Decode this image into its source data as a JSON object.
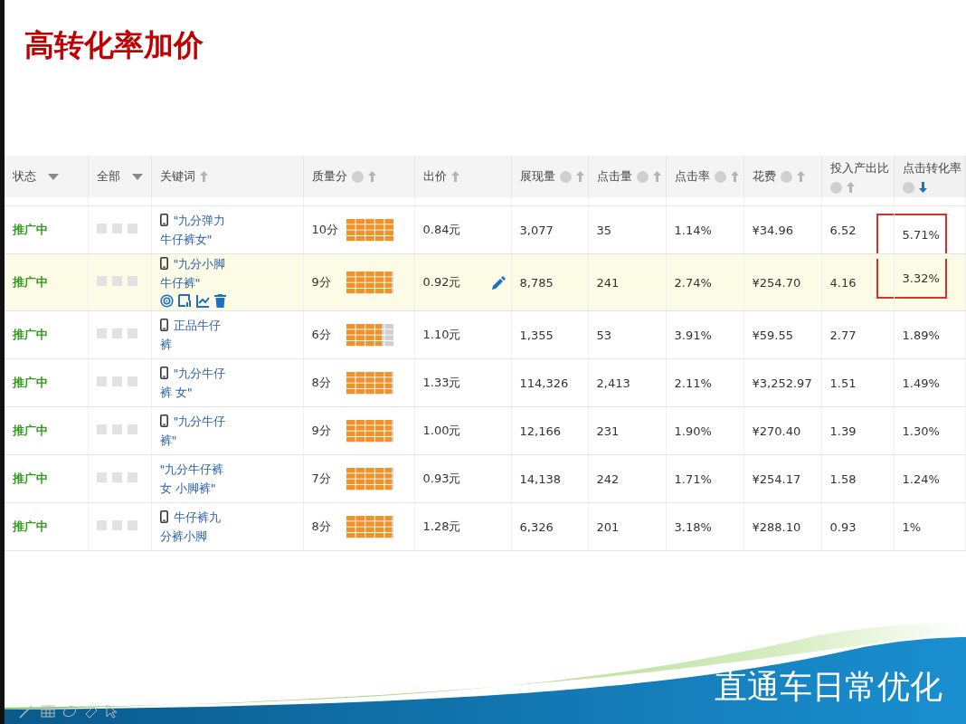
{
  "slide_title": "高转化率加价",
  "columns": [
    {
      "label": "状态",
      "kind": "dropdown",
      "info": false,
      "sort_active": false
    },
    {
      "label": "全部",
      "kind": "dropdown",
      "info": false,
      "sort_active": false
    },
    {
      "label": "关键词",
      "kind": "sort",
      "info": false,
      "sort_active": false
    },
    {
      "label": "质量分",
      "kind": "sort",
      "info": true,
      "sort_active": false
    },
    {
      "label": "出价",
      "kind": "sort",
      "info": false,
      "sort_active": false
    },
    {
      "label": "展现量",
      "kind": "sort",
      "info": true,
      "sort_active": false
    },
    {
      "label": "点击量",
      "kind": "sort",
      "info": true,
      "sort_active": false
    },
    {
      "label": "点击率",
      "kind": "sort",
      "info": true,
      "sort_active": false
    },
    {
      "label": "花费",
      "kind": "sort",
      "info": true,
      "sort_active": false
    },
    {
      "label": "投入产出比",
      "kind": "sort",
      "info": true,
      "sort_active": false
    },
    {
      "label": "点击转化率",
      "kind": "sort",
      "info": true,
      "sort_active": true
    }
  ],
  "rows": [
    {
      "status": "推广中",
      "mobile": true,
      "keyword": "\"九分弹力牛仔裤女\"",
      "score": "10分",
      "level": 1,
      "bid": "0.84元",
      "impressions": "3,077",
      "clicks": "35",
      "ctr": "1.14%",
      "cost": "¥34.96",
      "roi": "6.52",
      "cvr": "5.71%",
      "highlighted": false,
      "boxed": true
    },
    {
      "status": "推广中",
      "mobile": true,
      "keyword": "\"九分小脚牛仔裤\"",
      "score": "9分",
      "level": 0.95,
      "bid": "0.92元",
      "impressions": "8,785",
      "clicks": "241",
      "ctr": "2.74%",
      "cost": "¥254.70",
      "roi": "4.16",
      "cvr": "3.32%",
      "highlighted": true,
      "boxed": true
    },
    {
      "status": "推广中",
      "mobile": true,
      "keyword": "正品牛仔裤",
      "score": "6分",
      "level": 0.75,
      "bid": "1.10元",
      "impressions": "1,355",
      "clicks": "53",
      "ctr": "3.91%",
      "cost": "¥59.55",
      "roi": "2.77",
      "cvr": "1.89%",
      "highlighted": false,
      "boxed": false
    },
    {
      "status": "推广中",
      "mobile": true,
      "keyword": "\"九分牛仔裤 女\"",
      "score": "8分",
      "level": 0.95,
      "bid": "1.33元",
      "impressions": "114,326",
      "clicks": "2,413",
      "ctr": "2.11%",
      "cost": "¥3,252.97",
      "roi": "1.51",
      "cvr": "1.49%",
      "highlighted": false,
      "boxed": false
    },
    {
      "status": "推广中",
      "mobile": true,
      "keyword": "\"九分牛仔裤\"",
      "score": "9分",
      "level": 0.95,
      "bid": "1.00元",
      "impressions": "12,166",
      "clicks": "231",
      "ctr": "1.90%",
      "cost": "¥270.40",
      "roi": "1.39",
      "cvr": "1.30%",
      "highlighted": false,
      "boxed": false
    },
    {
      "status": "推广中",
      "mobile": false,
      "keyword": "\"九分牛仔裤女 小脚裤\"",
      "score": "7分",
      "level": 0.95,
      "bid": "0.93元",
      "impressions": "14,138",
      "clicks": "242",
      "ctr": "1.71%",
      "cost": "¥254.17",
      "roi": "1.58",
      "cvr": "1.24%",
      "highlighted": false,
      "boxed": false
    },
    {
      "status": "推广中",
      "mobile": true,
      "keyword": "牛仔裤九分裤小脚",
      "score": "8分",
      "level": 0.95,
      "bid": "1.28元",
      "impressions": "6,326",
      "clicks": "201",
      "ctr": "3.18%",
      "cost": "¥288.10",
      "roi": "0.93",
      "cvr": "1%",
      "highlighted": false,
      "boxed": false
    }
  ],
  "footer_title": "直通车日常优化"
}
